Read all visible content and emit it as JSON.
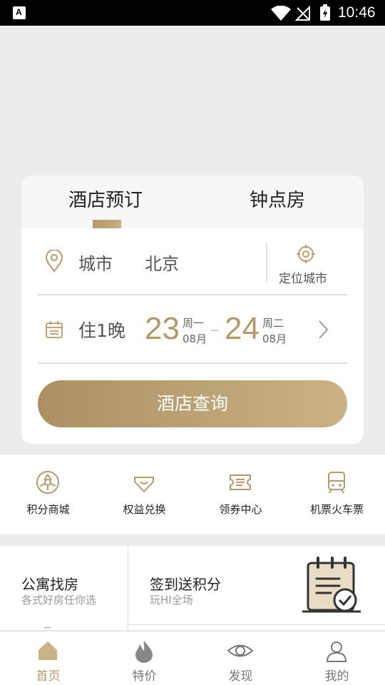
{
  "status_bar": {
    "time": "10:46",
    "app_badge": "A"
  },
  "booking": {
    "tabs": [
      {
        "label": "酒店预订",
        "active": true
      },
      {
        "label": "钟点房",
        "active": false
      }
    ],
    "city_label": "城市",
    "city_value": "北京",
    "locate_label": "定位城市",
    "nights_label": "住1晚",
    "checkin": {
      "day": "23",
      "weekday": "周一",
      "month": "08月"
    },
    "checkout": {
      "day": "24",
      "weekday": "周二",
      "month": "08月"
    },
    "search_label": "酒店查询"
  },
  "quick_links": [
    {
      "label": "积分商城",
      "icon": "points-mall-icon"
    },
    {
      "label": "权益兑换",
      "icon": "benefit-exchange-icon"
    },
    {
      "label": "领券中心",
      "icon": "coupon-center-icon"
    },
    {
      "label": "机票火车票",
      "icon": "train-ticket-icon"
    }
  ],
  "promos": [
    {
      "title": "公寓找房",
      "subtitle": "各式好房任你选"
    },
    {
      "title": "签到送积分",
      "subtitle": "玩HI全场"
    }
  ],
  "bottom_nav": [
    {
      "label": "首页",
      "icon": "home-icon",
      "active": true
    },
    {
      "label": "特价",
      "icon": "flame-icon",
      "active": false
    },
    {
      "label": "发现",
      "icon": "eye-icon",
      "active": false
    },
    {
      "label": "我的",
      "icon": "user-icon",
      "active": false
    }
  ],
  "colors": {
    "accent": "#b49a68",
    "background": "#ececec",
    "status_bar": "#000000"
  }
}
